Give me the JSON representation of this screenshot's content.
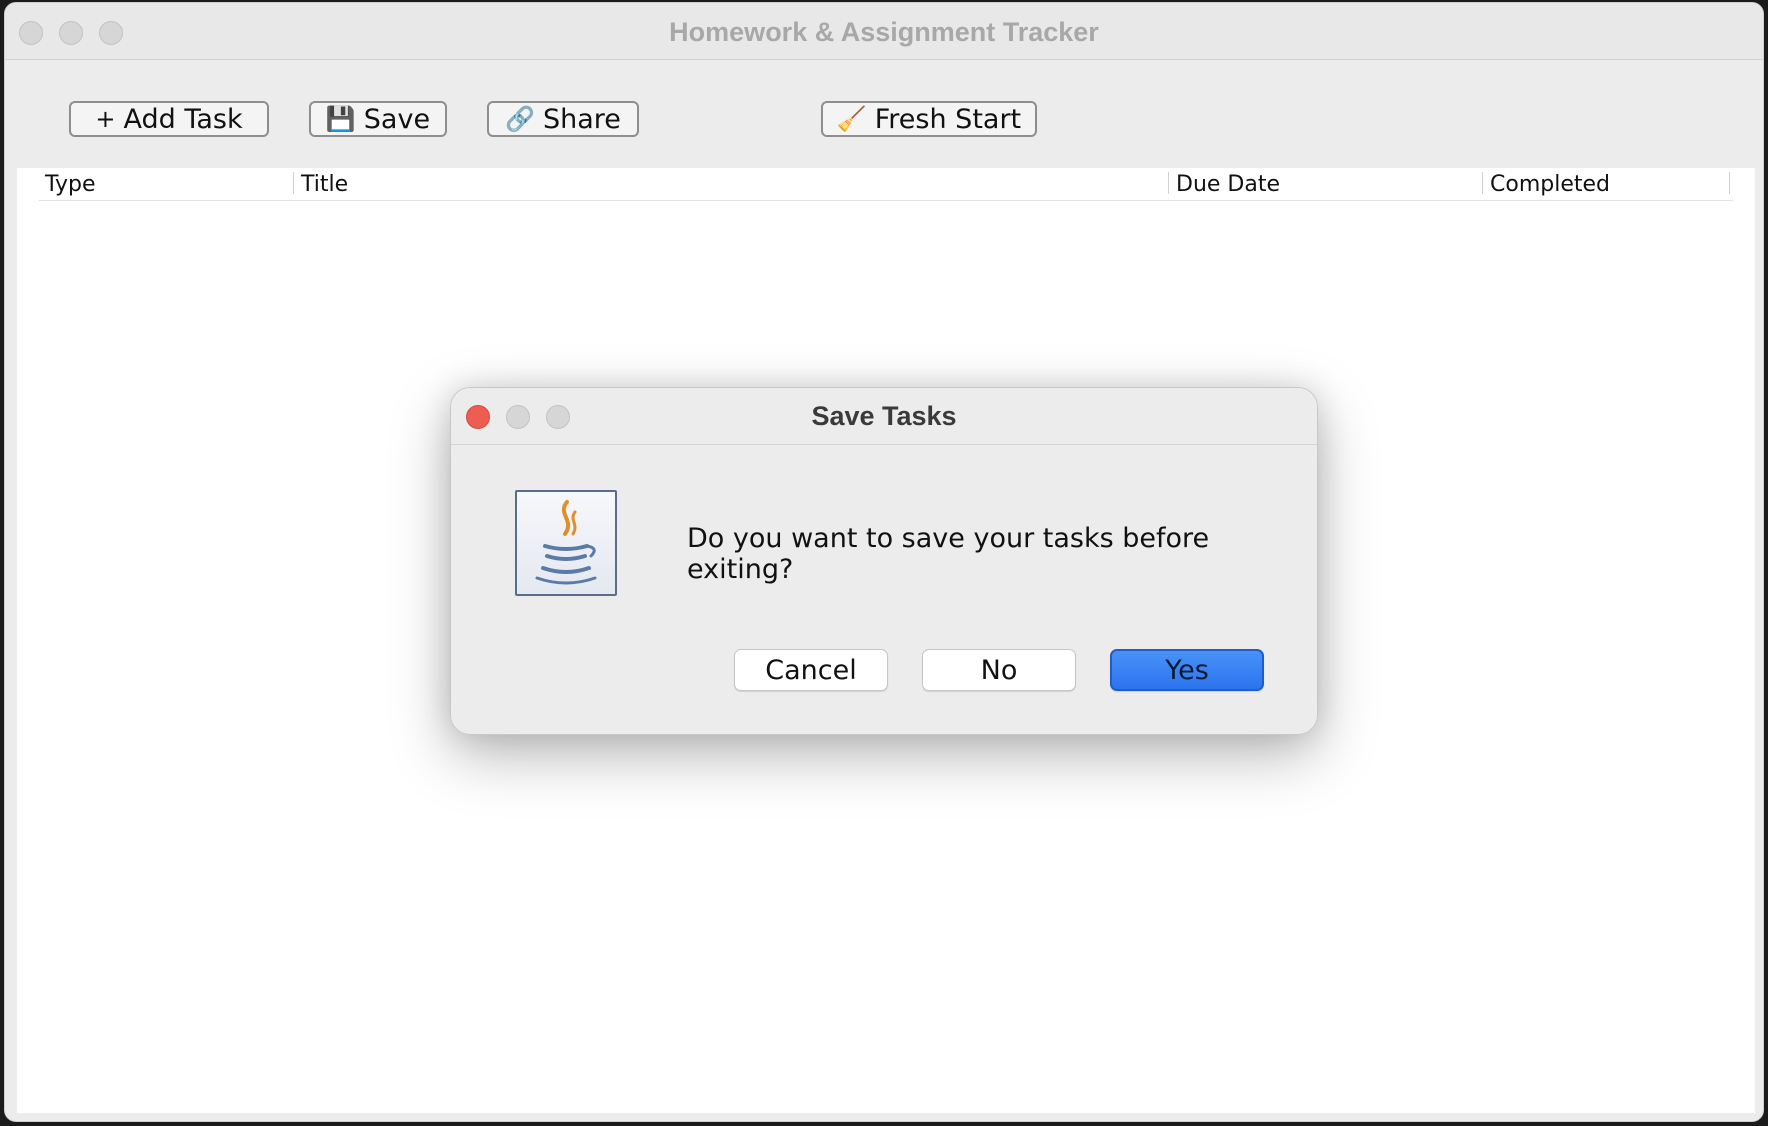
{
  "window": {
    "title": "Homework & Assignment Tracker"
  },
  "toolbar": {
    "add_task_icon": "+",
    "add_task_label": "Add Task",
    "save_icon": "💾",
    "save_label": "Save",
    "share_icon": "🔗",
    "share_label": "Share",
    "fresh_start_icon": "🧹",
    "fresh_start_label": "Fresh Start"
  },
  "table": {
    "columns": [
      "Type",
      "Title",
      "Due Date",
      "Completed"
    ],
    "rows": []
  },
  "dialog": {
    "title": "Save Tasks",
    "icon": "java-coffee-cup-icon",
    "message": "Do you want to save your tasks before exiting?",
    "buttons": {
      "cancel": "Cancel",
      "no": "No",
      "yes": "Yes"
    },
    "close_color": "#ee5d52",
    "primary_color": "#2f78f0"
  }
}
